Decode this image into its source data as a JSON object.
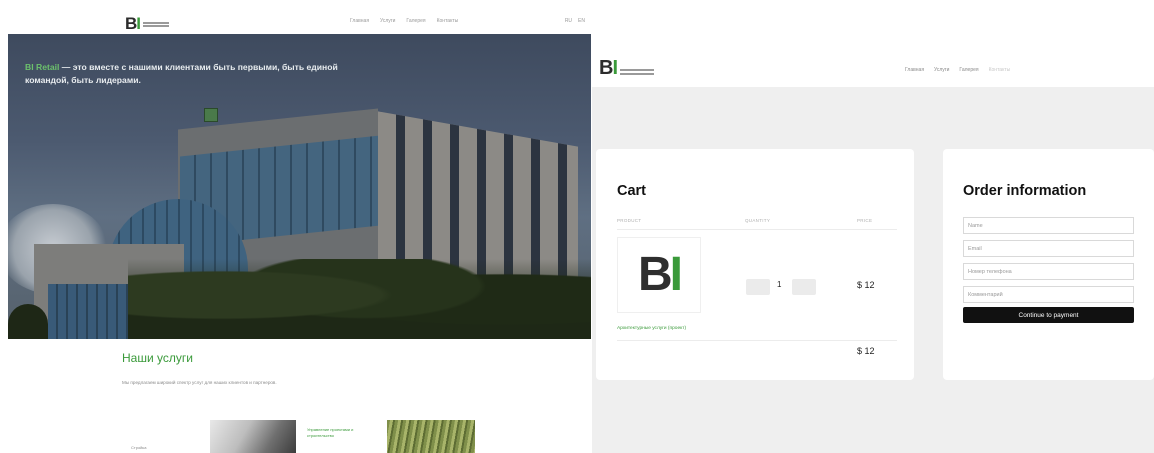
{
  "landing": {
    "logo": {
      "mark_dark": "B",
      "mark_green": "I"
    },
    "nav": [
      "Главная",
      "Услуги",
      "Галерея",
      "Контакты"
    ],
    "lang": [
      "RU",
      "EN"
    ],
    "hero": {
      "brand": "BI Retail",
      "headline": " — это вместе с нашими клиентами быть первыми, быть единой командой, быть лидерами."
    },
    "services": {
      "title": "Наши услуги",
      "description": "Мы предлагаем широкий спектр услуг для наших клиентов и партнеров.",
      "item1_label": "Стройка",
      "item2_label": "Управление проектами и строительство"
    }
  },
  "shop": {
    "logo": {
      "mark_dark": "B",
      "mark_green": "I"
    },
    "nav": [
      "Главная",
      "Услуги",
      "Галерея",
      "Контакты"
    ],
    "cart": {
      "title": "Cart",
      "columns": {
        "product": "PRODUCT",
        "quantity": "QUANTITY",
        "price": "PRICE"
      },
      "item": {
        "image_mark_dark": "B",
        "image_mark_green": "I",
        "quantity": "1",
        "price": "$ 12",
        "name": "Архитектурные услуги (проект)"
      },
      "total": "$ 12"
    },
    "order": {
      "title": "Order information",
      "name_placeholder": "Name",
      "email_placeholder": "Email",
      "phone_placeholder": "Номер телефона",
      "comment_placeholder": "Комментарий",
      "submit_label": "Continue to payment"
    }
  },
  "colors": {
    "brand_green": "#3a9a3a",
    "dark": "#111111",
    "page_bg": "#efefef"
  },
  "icons": [
    "minus-icon",
    "plus-icon"
  ]
}
